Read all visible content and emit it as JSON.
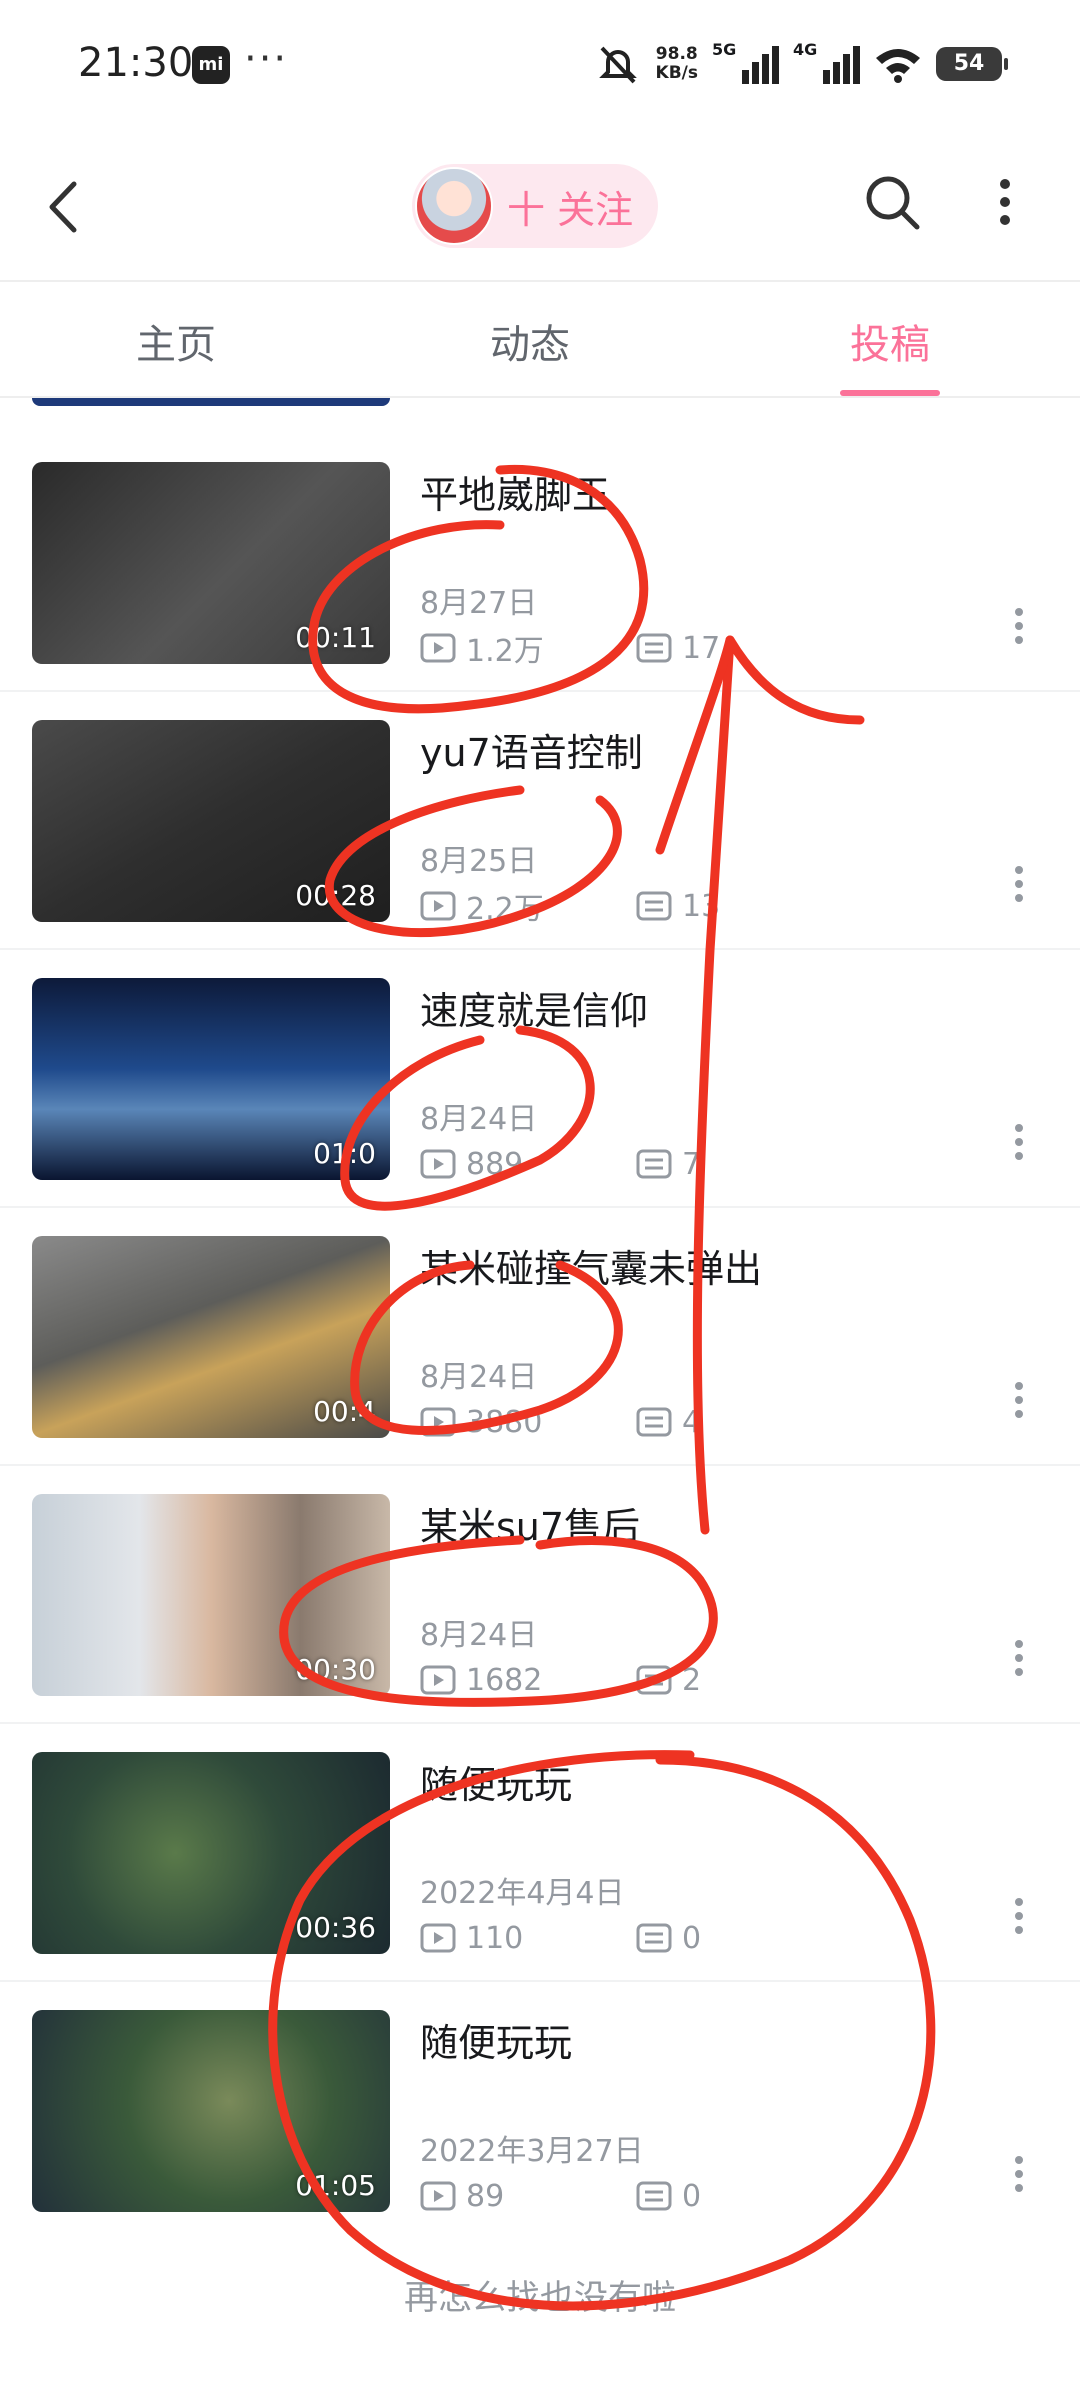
{
  "status_bar": {
    "time": "21:30",
    "net_speed_value": "98.8",
    "net_speed_unit": "KB/s",
    "sim1_label": "5G",
    "sim2_label": "4G",
    "battery": "54"
  },
  "header": {
    "follow_label": "十 关注",
    "icons": [
      "back-icon",
      "search-icon",
      "more-icon"
    ]
  },
  "tabs": [
    {
      "label": "主页",
      "active": false
    },
    {
      "label": "动态",
      "active": false
    },
    {
      "label": "投稿",
      "active": true
    }
  ],
  "videos": [
    {
      "title": "平地崴脚王",
      "duration": "00:11",
      "date": "8月27日",
      "views": "1.2万",
      "comments": "17"
    },
    {
      "title": "yu7语音控制",
      "duration": "00:28",
      "date": "8月25日",
      "views": "2.2万",
      "comments": "13"
    },
    {
      "title": "速度就是信仰",
      "duration": "01:0",
      "date": "8月24日",
      "views": "889",
      "comments": "7"
    },
    {
      "title": "某米碰撞气囊未弹出",
      "duration": "00:4",
      "date": "8月24日",
      "views": "3880",
      "comments": "4"
    },
    {
      "title": "某米su7售后",
      "duration": "00:30",
      "date": "8月24日",
      "views": "1682",
      "comments": "2"
    },
    {
      "title": "随便玩玩",
      "duration": "00:36",
      "date": "2022年4月4日",
      "views": "110",
      "comments": "0"
    },
    {
      "title": "随便玩玩",
      "duration": "01:05",
      "date": "2022年3月27日",
      "views": "89",
      "comments": "0"
    }
  ],
  "footer_text": "再怎么找也没有啦",
  "colors": {
    "accent": "#fb7299",
    "annotation": "#ee3322",
    "text_secondary": "#9499a0"
  }
}
